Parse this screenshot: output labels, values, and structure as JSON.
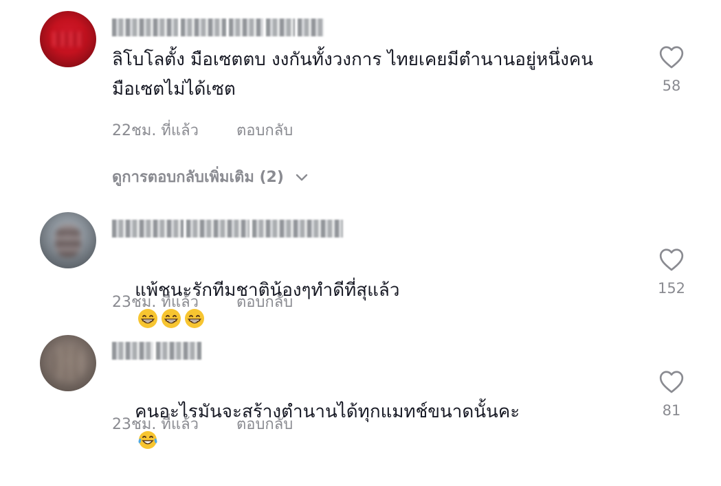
{
  "comments": [
    {
      "text": "ลิโบโลตั้ง มือเซตตบ งงกันทั้งวงการ ไทยเคยมีตำนานอยู่หนึ่งคน มือเซตไม่ได้เซต",
      "time": "22ชม. ที่แล้ว",
      "reply": "ตอบกลับ",
      "likes": "58",
      "avatar_color": "#c4121f"
    },
    {
      "text": "แพ้ชนะรักทีมชาติน้องๆทำดีที่สุแล้ว",
      "emojis": [
        "grinning-face",
        "grinning-face",
        "grinning-face"
      ],
      "time": "23ชม. ที่แล้ว",
      "reply": "ตอบกลับ",
      "likes": "152",
      "avatar_color": "#8f979f"
    },
    {
      "text": "คนอะไรมันจะสร้างตำนานได้ทุกแมทช์ขนาดนั้นคะ",
      "emojis": [
        "face-with-tears-of-joy"
      ],
      "time": "23ชม. ที่แล้ว",
      "reply": "ตอบกลับ",
      "likes": "81",
      "avatar_color": "#7e716a"
    }
  ],
  "view_more_replies": "ดูการตอบกลับเพิ่มเติม (2)",
  "icons": {
    "like": "heart-outline-icon",
    "expand": "chevron-down-icon"
  },
  "colors": {
    "text": "#161823",
    "secondary": "#8a8b91",
    "emoji": "#f7c531"
  }
}
